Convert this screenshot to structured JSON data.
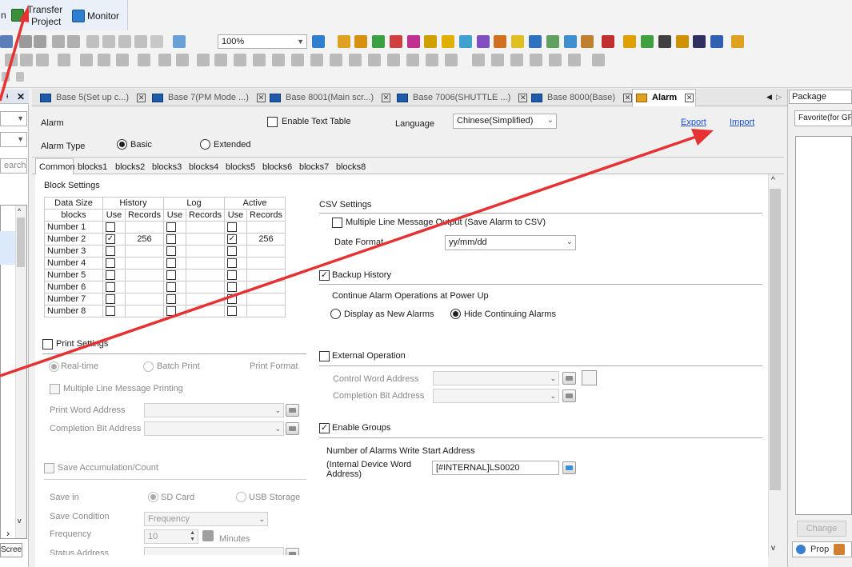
{
  "toolbar": {
    "menu_prefix": "n",
    "transfer_line1": "Transfer",
    "transfer_line2": "Project",
    "monitor": "Monitor",
    "zoom": "100%"
  },
  "left_panel": {
    "search": "earch",
    "bottom_tab": "Scree"
  },
  "tabs": [
    {
      "label": "Base 5(Set up c...)"
    },
    {
      "label": "Base 7(PM Mode ...)"
    },
    {
      "label": "Base 8001(Main scr...)"
    },
    {
      "label": "Base 7006(SHUTTLE ...)"
    },
    {
      "label": "Base 8000(Base)"
    },
    {
      "label": "Alarm"
    }
  ],
  "header": {
    "title": "Alarm",
    "enable_text_table": "Enable Text Table",
    "language_label": "Language",
    "language_value": "Chinese(Simplified)",
    "export": "Export",
    "import": "Import",
    "alarm_type_label": "Alarm Type",
    "basic": "Basic",
    "extended": "Extended"
  },
  "subtabs": [
    "Common",
    "blocks1",
    "blocks2",
    "blocks3",
    "blocks4",
    "blocks5",
    "blocks6",
    "blocks7",
    "blocks8"
  ],
  "block_settings": {
    "title": "Block Settings",
    "col_data_size": "Data Size",
    "col_history": "History",
    "col_log": "Log",
    "col_active": "Active",
    "col_blocks": "blocks",
    "col_use": "Use",
    "col_records": "Records",
    "rows": [
      {
        "name": "Number 1",
        "hist": false,
        "hist_rec": "",
        "log": false,
        "act": false,
        "act_rec": ""
      },
      {
        "name": "Number 2",
        "hist": true,
        "hist_rec": "256",
        "log": false,
        "act": true,
        "act_rec": "256"
      },
      {
        "name": "Number 3",
        "hist": false,
        "hist_rec": "",
        "log": false,
        "act": false,
        "act_rec": ""
      },
      {
        "name": "Number 4",
        "hist": false,
        "hist_rec": "",
        "log": false,
        "act": false,
        "act_rec": ""
      },
      {
        "name": "Number 5",
        "hist": false,
        "hist_rec": "",
        "log": false,
        "act": false,
        "act_rec": ""
      },
      {
        "name": "Number 6",
        "hist": false,
        "hist_rec": "",
        "log": false,
        "act": false,
        "act_rec": ""
      },
      {
        "name": "Number 7",
        "hist": false,
        "hist_rec": "",
        "log": false,
        "act": false,
        "act_rec": ""
      },
      {
        "name": "Number 8",
        "hist": false,
        "hist_rec": "",
        "log": false,
        "act": false,
        "act_rec": ""
      }
    ]
  },
  "print": {
    "title": "Print Settings",
    "realtime": "Real-time",
    "batch": "Batch Print",
    "format": "Print Format",
    "multi": "Multiple Line Message Printing",
    "word_addr": "Print Word Address",
    "comp_addr": "Completion Bit Address"
  },
  "save": {
    "title": "Save Accumulation/Count",
    "save_in": "Save in",
    "sd": "SD Card",
    "usb": "USB Storage",
    "condition": "Save Condition",
    "condition_value": "Frequency",
    "frequency": "Frequency",
    "frequency_value": "10",
    "minutes": "Minutes",
    "status": "Status Address"
  },
  "csv": {
    "title": "CSV Settings",
    "multi": "Multiple Line Message Output (Save Alarm to CSV)",
    "date_format": "Date Format",
    "date_value": "yy/mm/dd"
  },
  "backup": {
    "title": "Backup History",
    "continue": "Continue Alarm Operations at Power Up",
    "display_new": "Display as New Alarms",
    "hide": "Hide Continuing Alarms"
  },
  "external": {
    "title": "External Operation",
    "control": "Control Word Address",
    "completion": "Completion Bit Address"
  },
  "groups": {
    "title": "Enable Groups",
    "write_start": "Number of Alarms Write Start Address",
    "internal1": "(Internal Device Word",
    "internal2": "Address)",
    "address_value": "[#INTERNAL]LS0020"
  },
  "right_panel": {
    "title": "Package",
    "combo": "Favorite(for GP",
    "change": "Change",
    "prop": "Prop"
  }
}
